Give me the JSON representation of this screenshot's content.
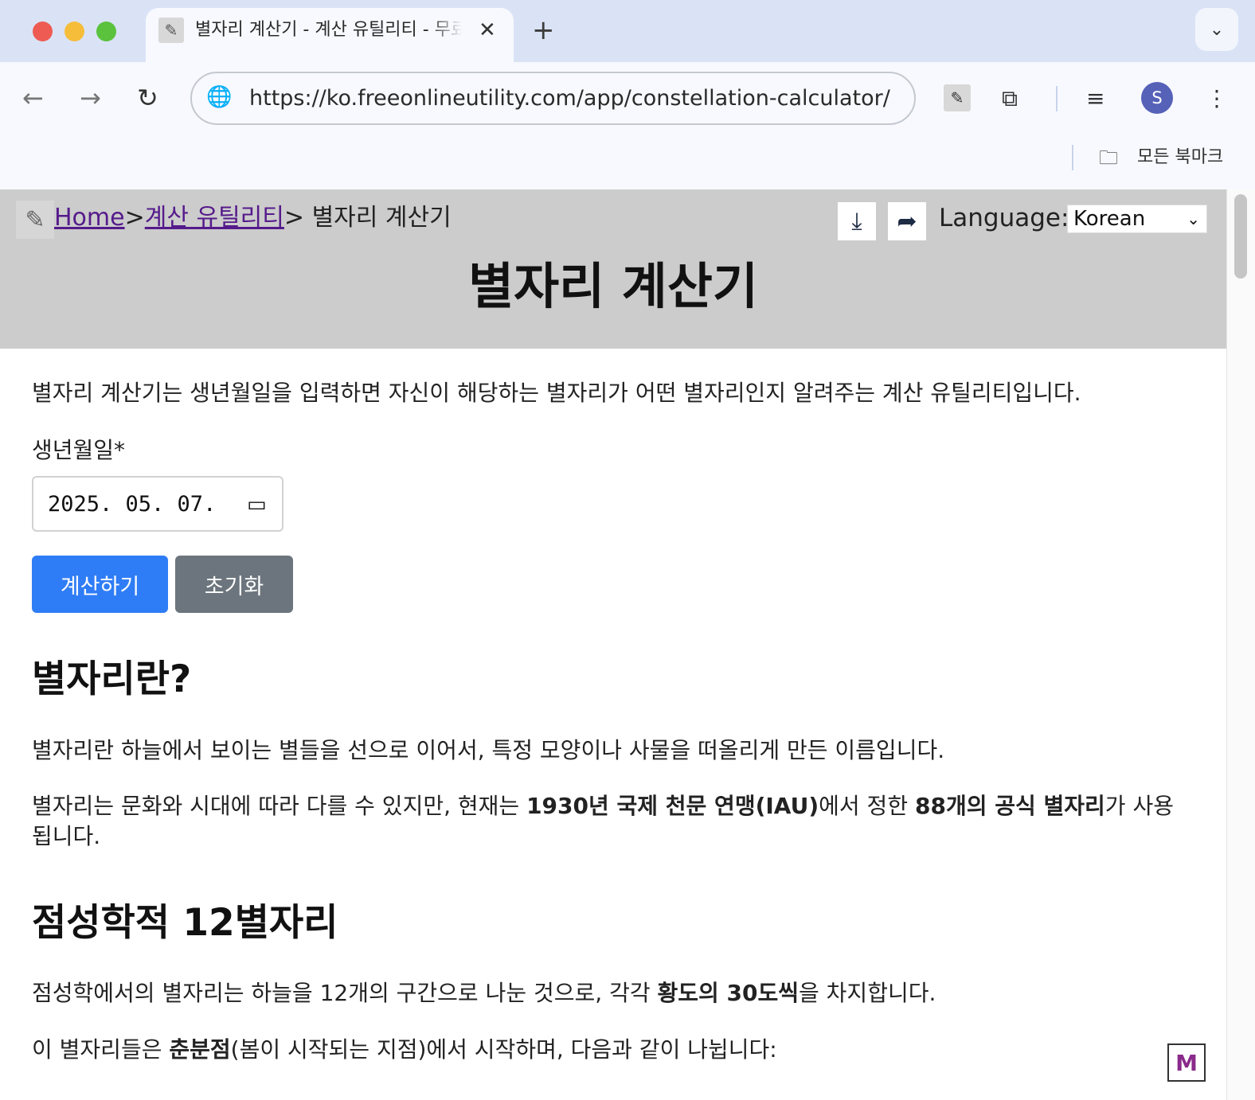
{
  "browser": {
    "tab_title": "별자리 계산기 - 계산 유틸리티 - 무료 온라인 유틸리티",
    "url": "https://ko.freeonlineutility.com/app/constellation-calculator/",
    "avatar_letter": "S",
    "bookmarks_label": "모든 북마크"
  },
  "header": {
    "breadcrumb_home": "Home",
    "breadcrumb_sep1": ">",
    "breadcrumb_category": "계산 유틸리티",
    "breadcrumb_sep2": "> ",
    "breadcrumb_current": "별자리 계산기",
    "language_label": "Language:",
    "language_value": "Korean",
    "title": "별자리 계산기"
  },
  "form": {
    "intro": "별자리 계산기는 생년월일을 입력하면 자신이 해당하는 별자리가 어떤 별자리인지 알려주는 계산 유틸리티입니다.",
    "birth_label": "생년월일*",
    "birth_value": "2025. 05. 07.",
    "calc_button": "계산하기",
    "reset_button": "초기화"
  },
  "sections": {
    "s1_title": "별자리란?",
    "s1_p1": "별자리란 하늘에서 보이는 별들을 선으로 이어서, 특정 모양이나 사물을 떠올리게 만든 이름입니다.",
    "s1_p2_a": "별자리는 문화와 시대에 따라 다를 수 있지만, 현재는 ",
    "s1_p2_b": "1930년 국제 천문 연맹(IAU)",
    "s1_p2_c": "에서 정한 ",
    "s1_p2_d": "88개의 공식 별자리",
    "s1_p2_e": "가 사용됩니다.",
    "s2_title": "점성학적 12별자리",
    "s2_p1_a": "점성학에서의 별자리는 하늘을 12개의 구간으로 나눈 것으로, 각각 ",
    "s2_p1_b": "황도의 30도씩",
    "s2_p1_c": "을 차지합니다.",
    "s2_p2_a": "이 별자리들은 ",
    "s2_p2_b": "춘분점",
    "s2_p2_c": "(봄이 시작되는 지점)에서 시작하며, 다음과 같이 나뉩니다:"
  }
}
